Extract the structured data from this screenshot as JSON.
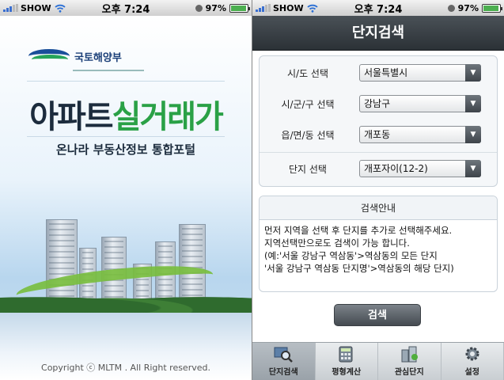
{
  "status_bar": {
    "carrier": "SHOW",
    "time": "오후 7:24",
    "battery": "97%",
    "battery_level": 0.97
  },
  "splash": {
    "ministry_name": "국토해양부",
    "app_title_part1": "아파트",
    "app_title_part2": "실거래가",
    "subtitle": "온나라 부동산정보 통합포털",
    "copyright": "Copyright ⓒ MLTM . All Right reserved."
  },
  "search": {
    "title": "단지검색",
    "fields": [
      {
        "label": "시/도 선택",
        "value": "서울특별시"
      },
      {
        "label": "시/군/구 선택",
        "value": "강남구"
      },
      {
        "label": "읍/면/동 선택",
        "value": "개포동"
      },
      {
        "label": "단지 선택",
        "value": "개포자이(12-2)"
      }
    ],
    "guide_title": "검색안내",
    "guide_lines": [
      "먼저 지역을 선택 후 단지를 추가로 선택해주세요.",
      "지역선택만으로도 검색이 가능 합니다.",
      "(예:'서울 강남구 역삼동'>역삼동의 모든 단지",
      "'서울 강남구 역삼동 단지명'>역삼동의 해당 단지)"
    ],
    "search_button": "검색"
  },
  "tabs": [
    {
      "label": "단지검색",
      "icon": "search-map-icon",
      "active": true
    },
    {
      "label": "평형계산",
      "icon": "calculator-icon",
      "active": false
    },
    {
      "label": "관심단지",
      "icon": "building-icon",
      "active": false
    },
    {
      "label": "설정",
      "icon": "gear-icon",
      "active": false
    }
  ]
}
